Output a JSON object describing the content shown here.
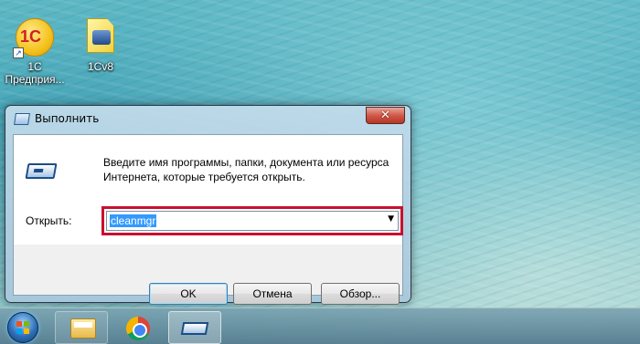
{
  "desktop": {
    "icons": [
      {
        "label_line1": "1С",
        "label_line2": "Предприя...",
        "logo_text": "1С",
        "shortcut_glyph": "↗"
      },
      {
        "label_line1": "1Cv8"
      }
    ]
  },
  "dialog": {
    "title": "Выполнить",
    "close_glyph": "✕",
    "description_line1": "Введите имя программы, папки, документа или ресурса",
    "description_line2": "Интернета, которые требуется открыть.",
    "open_label": "Открыть:",
    "command_value": "cleanmgr",
    "dropdown_glyph": "▼",
    "buttons": {
      "ok": "OK",
      "cancel": "Отмена",
      "browse": "Обзор..."
    },
    "highlight_color": "#c8102e"
  },
  "taskbar": {
    "items": [
      "start-button",
      "windows-explorer",
      "google-chrome",
      "run-dialog"
    ]
  }
}
